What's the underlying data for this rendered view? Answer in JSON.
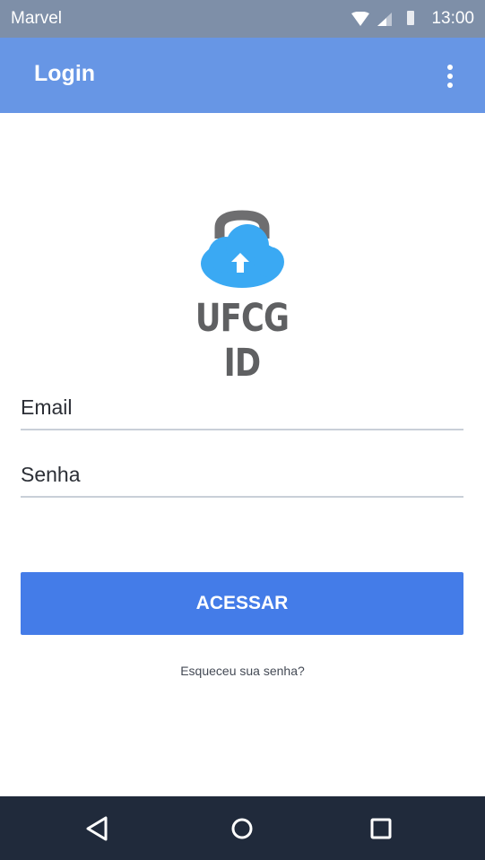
{
  "status_bar": {
    "carrier": "Marvel",
    "time": "13:00",
    "icons": [
      "wifi-icon",
      "signal-icon",
      "battery-icon"
    ]
  },
  "app_bar": {
    "title": "Login",
    "menu_icon": "more-vertical-icon"
  },
  "logo": {
    "text": "UFCG ID",
    "icon": "cloud-lock-upload-icon",
    "colors": {
      "cloud": "#3aa9f3",
      "lock": "#6e6e70",
      "text": "#5f6062"
    }
  },
  "form": {
    "email_placeholder": "Email",
    "password_placeholder": "Senha",
    "submit_label": "ACESSAR",
    "forgot_label": "Esqueceu sua senha?"
  },
  "nav_bar": {
    "buttons": [
      "back-icon",
      "home-icon",
      "recents-icon"
    ]
  },
  "colors": {
    "status_bar": "#7e8fa8",
    "app_bar": "#6796e5",
    "button": "#447ce8",
    "nav_bar": "#202a3b"
  }
}
